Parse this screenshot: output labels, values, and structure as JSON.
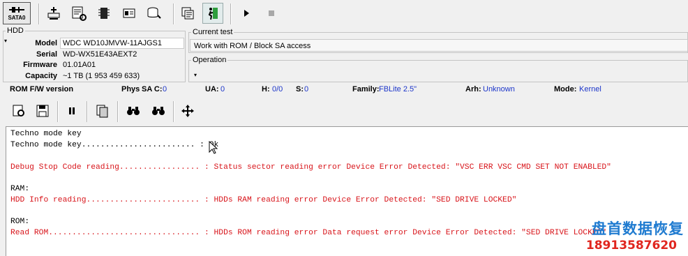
{
  "toolbar": {
    "sata_label": "SATA0",
    "buttons": [
      "hdd-tools-icon",
      "utilities-icon",
      "chip-icon",
      "id-card-icon",
      "database-icon",
      "copy-icon",
      "exit-icon",
      "play-icon",
      "stop-icon"
    ]
  },
  "hdd": {
    "group_title": "HDD",
    "model_label": "Model",
    "model": "WDC WD10JMVW-11AJGS1",
    "serial_label": "Serial",
    "serial": "WD-WX51E43AEXT2",
    "firmware_label": "Firmware",
    "firmware": "01.01A01",
    "capacity_label": "Capacity",
    "capacity": "~1 TB (1 953 459 633)"
  },
  "current_test": {
    "title": "Current test",
    "value": "Work with ROM / Block SA access"
  },
  "operation": {
    "title": "Operation"
  },
  "status": {
    "rom_fw": "ROM F/W version",
    "phys_label": "Phys",
    "sac_label": "SA C:",
    "sac": "0",
    "ua_label": "UA:",
    "ua": "0",
    "h_label": "H:",
    "h": "0/0",
    "s_label": "S:",
    "s": "0",
    "family_label": "Family:",
    "family": "FBLite 2.5\"",
    "arh_label": "Arh:",
    "arh": "Unknown",
    "mode_label": "Mode:",
    "mode": "Kernel"
  },
  "log": {
    "l1": "Techno mode key",
    "l2": "Techno mode key........................ : Ok",
    "l3": "Debug Stop Code reading................. : Status sector reading error Device Error Detected: \"VSC ERR VSC CMD SET NOT ENABLED\"",
    "l4": "RAM:",
    "l5": "HDD Info reading........................ : HDDs RAM reading error Device Error Detected: \"SED DRIVE LOCKED\"",
    "l6": "ROM:",
    "l7": "Read ROM................................ : HDDs ROM reading error Data request error Device Error Detected: \"SED DRIVE LOCKED\""
  },
  "watermark": {
    "name": "盘首数据恢复",
    "phone": "18913587620"
  },
  "colors": {
    "error": "#d8141a",
    "blue": "#1c35c9"
  }
}
